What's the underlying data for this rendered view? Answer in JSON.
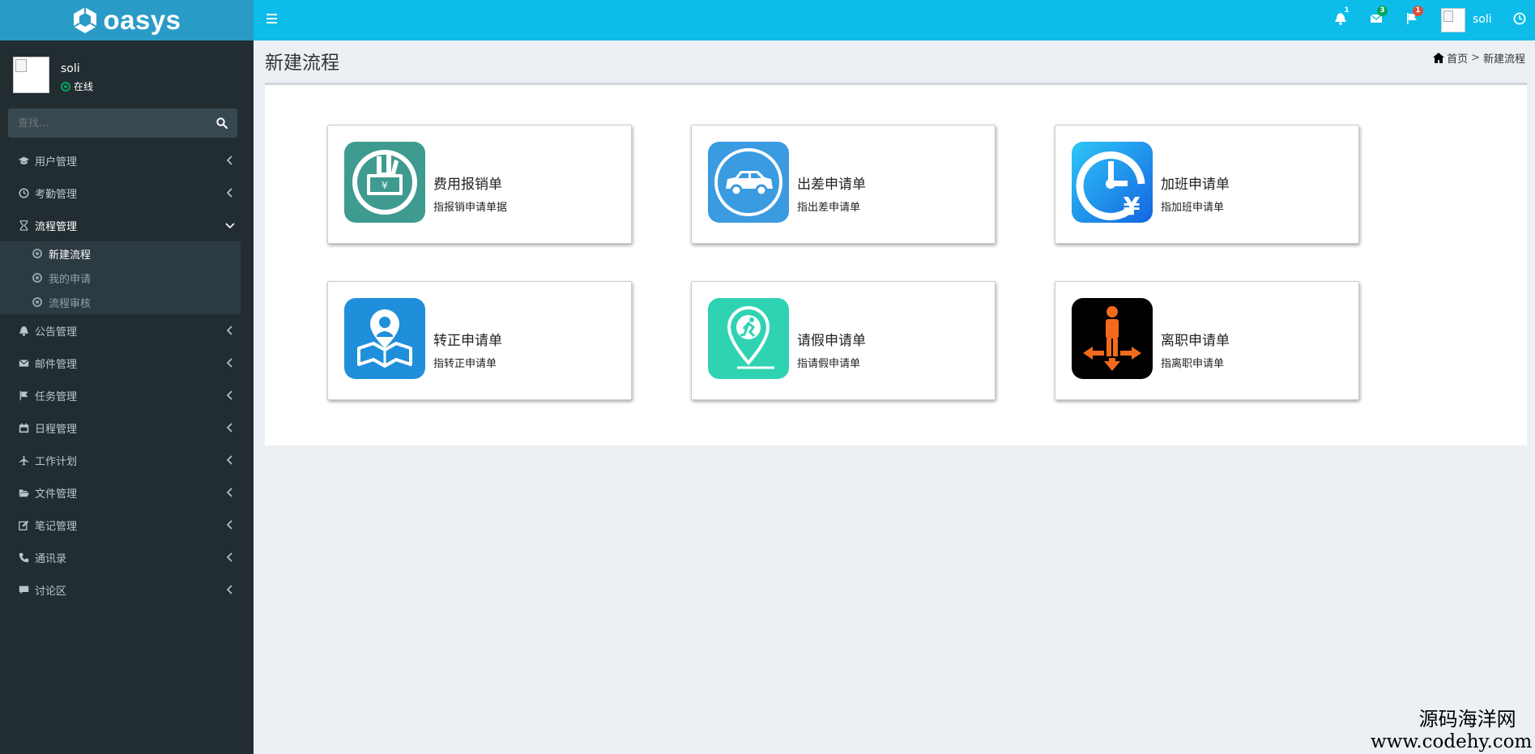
{
  "app": {
    "brand": "oasys"
  },
  "user": {
    "name": "soli",
    "status": "在线"
  },
  "search": {
    "placeholder": "查找..."
  },
  "nav": {
    "items": [
      {
        "label": "用户管理",
        "icon": "graduation-cap-icon"
      },
      {
        "label": "考勤管理",
        "icon": "clock-icon"
      },
      {
        "label": "流程管理",
        "icon": "hourglass-icon",
        "expanded": true
      },
      {
        "label": "公告管理",
        "icon": "bell-icon"
      },
      {
        "label": "邮件管理",
        "icon": "envelope-icon"
      },
      {
        "label": "任务管理",
        "icon": "flag-icon"
      },
      {
        "label": "日程管理",
        "icon": "calendar-icon"
      },
      {
        "label": "工作计划",
        "icon": "plane-icon"
      },
      {
        "label": "文件管理",
        "icon": "folder-open-icon"
      },
      {
        "label": "笔记管理",
        "icon": "edit-icon"
      },
      {
        "label": "通讯录",
        "icon": "phone-icon"
      },
      {
        "label": "讨论区",
        "icon": "comment-icon"
      }
    ],
    "sub_items": [
      {
        "label": "新建流程",
        "active": true
      },
      {
        "label": "我的申请"
      },
      {
        "label": "流程审核"
      }
    ]
  },
  "header": {
    "notifications": {
      "count": "1",
      "color": "#00c0ef"
    },
    "messages": {
      "count": "3",
      "color": "#00a65a"
    },
    "tasks": {
      "count": "1",
      "color": "#dd4b39"
    },
    "user_name": "soli"
  },
  "page": {
    "title": "新建流程",
    "breadcrumb": {
      "home": "首页",
      "separator": ">",
      "current": "新建流程"
    }
  },
  "cards": [
    {
      "title": "费用报销单",
      "desc": "指报销申请单据",
      "icon": "money-hand-icon"
    },
    {
      "title": "出差申请单",
      "desc": "指出差申请单",
      "icon": "car-icon"
    },
    {
      "title": "加班申请单",
      "desc": "指加班申请单",
      "icon": "clock-yen-icon"
    },
    {
      "title": "转正申请单",
      "desc": "指转正申请单",
      "icon": "person-map-icon"
    },
    {
      "title": "请假申请单",
      "desc": "指请假申请单",
      "icon": "runner-pin-icon"
    },
    {
      "title": "离职申请单",
      "desc": "指离职申请单",
      "icon": "person-arrows-icon"
    }
  ],
  "watermark": {
    "line1": "源码海洋网",
    "line2": "www.codehy.com"
  }
}
